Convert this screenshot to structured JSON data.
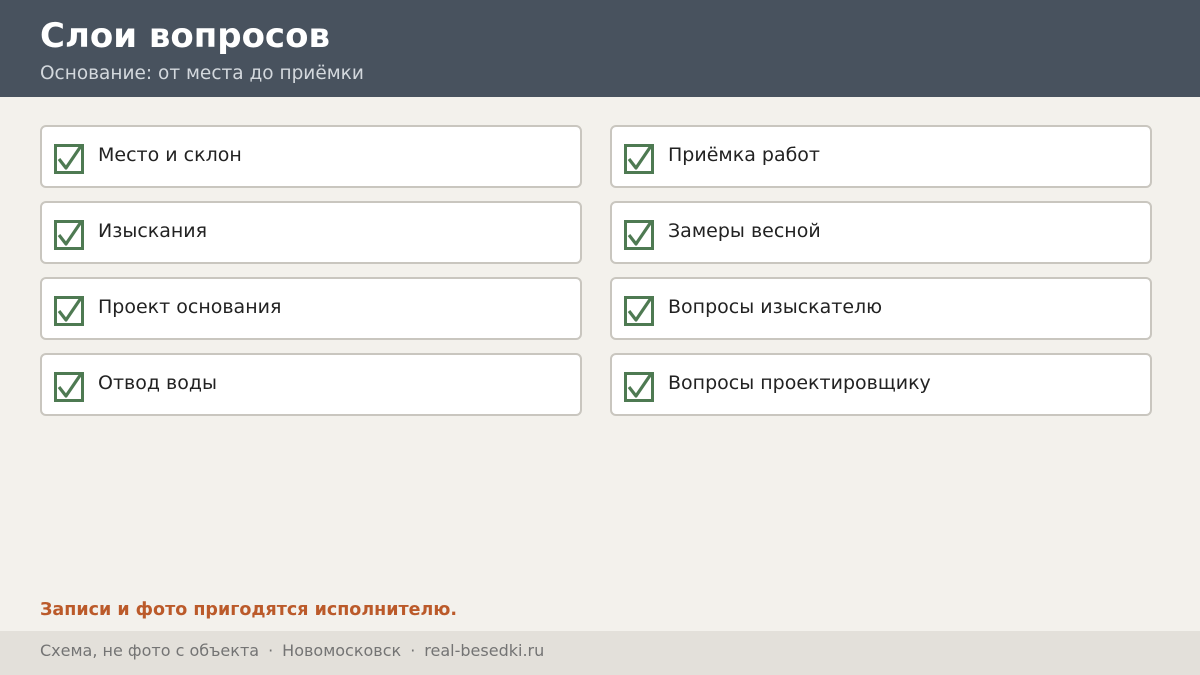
{
  "header": {
    "title": "Слои вопросов",
    "subtitle": "Основание: от места до приёмки"
  },
  "checklist": {
    "left": [
      {
        "label": "Место и склон",
        "checked": true
      },
      {
        "label": "Изыскания",
        "checked": true
      },
      {
        "label": "Проект основания",
        "checked": true
      },
      {
        "label": "Отвод воды",
        "checked": true
      }
    ],
    "right": [
      {
        "label": "Приёмка работ",
        "checked": true
      },
      {
        "label": "Замеры весной",
        "checked": true
      },
      {
        "label": "Вопросы изыскателю",
        "checked": true
      },
      {
        "label": "Вопросы проектировщику",
        "checked": true
      }
    ]
  },
  "note": "Записи и фото пригодятся исполнителю.",
  "footer": {
    "caption": "Схема, не фото с объекта",
    "separator": "·",
    "city": "Новомосковск",
    "site": "real-besedki.ru"
  },
  "colors": {
    "header_bg": "#48525e",
    "check_green": "#4e7a52",
    "note_accent": "#bb5a2a",
    "page_bg": "#f3f1ec"
  },
  "icons": {
    "check": "checkbox-checked-icon"
  }
}
